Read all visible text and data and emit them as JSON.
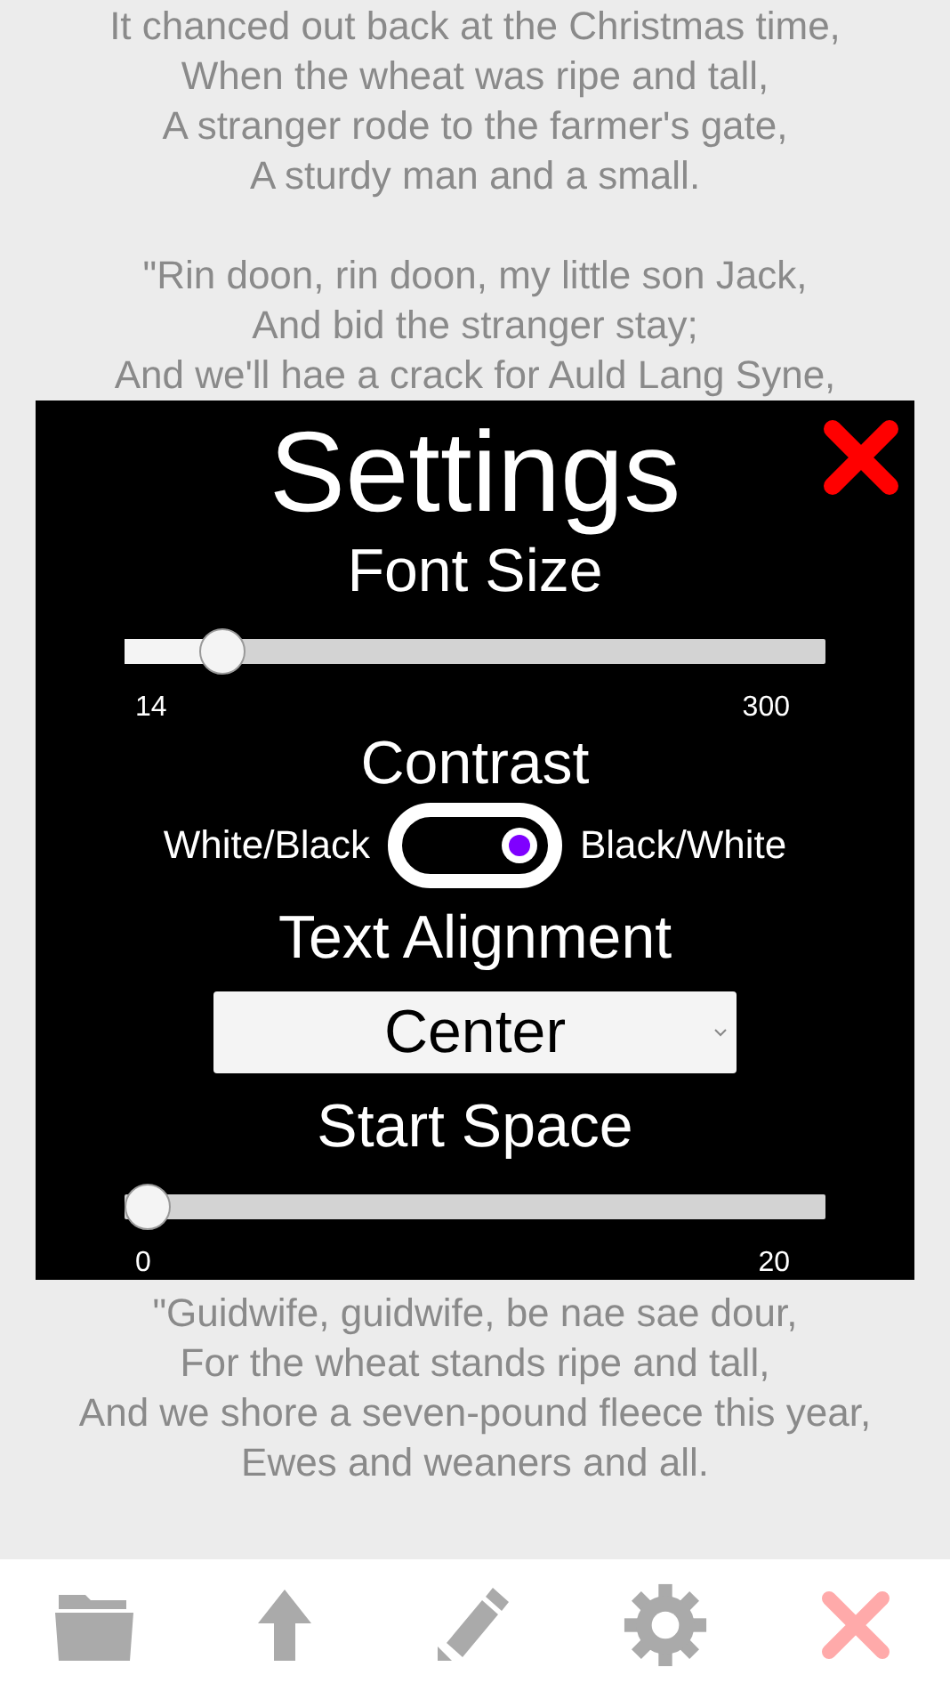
{
  "poem_top": [
    [
      "It chanced out back at the Christmas time,",
      "When the wheat was ripe and tall,",
      "A stranger rode to the farmer's gate,",
      "A sturdy man and a small."
    ],
    [
      "\"Rin doon, rin doon, my little son Jack,",
      "And bid the stranger stay;",
      "And we'll hae a crack for Auld Lang Syne,"
    ]
  ],
  "settings": {
    "title": "Settings",
    "sections": [
      {
        "kind": "slider",
        "label": "Font Size",
        "level": 0.14,
        "min": "14",
        "max": "300"
      },
      {
        "kind": "toggle",
        "label": "Contrast",
        "left": "White/Black",
        "right": "Black/White",
        "on": true
      },
      {
        "kind": "select",
        "label": "Text Alignment",
        "value": "Center"
      },
      {
        "kind": "slider",
        "label": "Start Space",
        "level": 0,
        "min": "0",
        "max": "20"
      }
    ]
  },
  "poem_bottom": [
    "\"Guidwife, guidwife, be nae sae dour,",
    "For the wheat stands ripe and tall,",
    "And we shore a seven-pound fleece this year,",
    "Ewes and weaners and all."
  ],
  "toolbar": [
    {
      "kind": "folder"
    },
    {
      "kind": "upload"
    },
    {
      "kind": "edit"
    },
    {
      "kind": "settings"
    },
    {
      "kind": "close"
    }
  ]
}
